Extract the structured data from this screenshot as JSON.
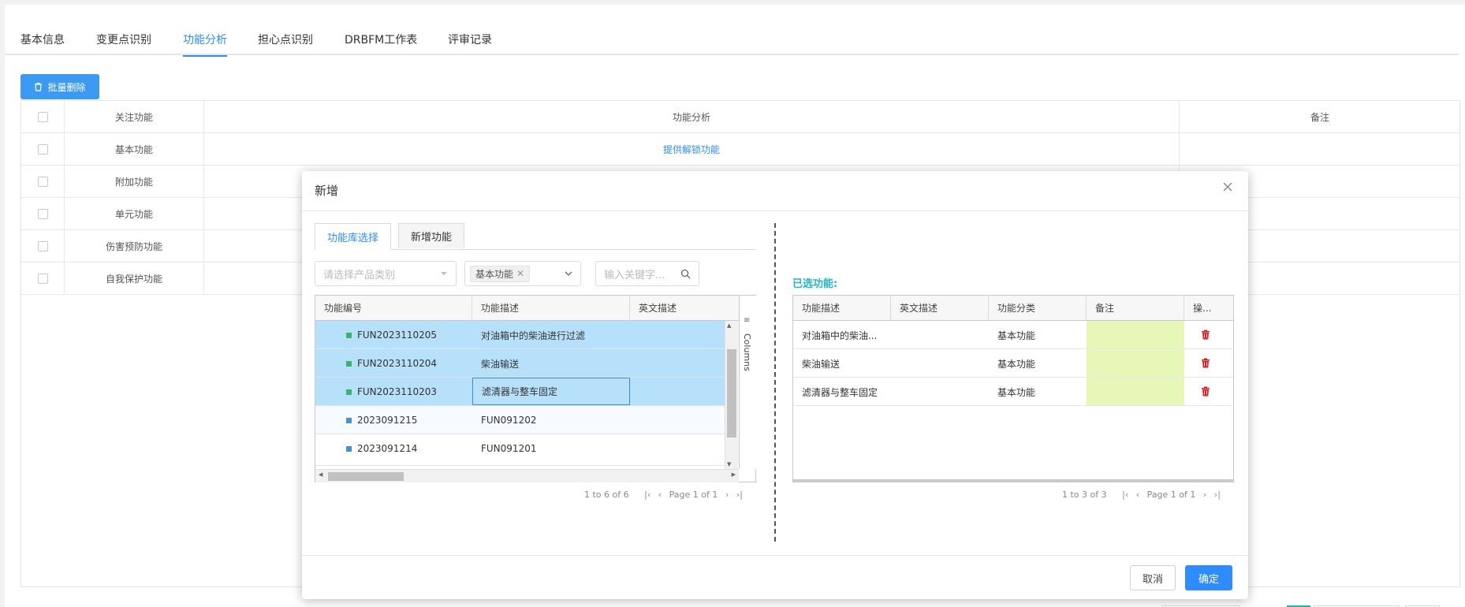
{
  "tabs": [
    "基本信息",
    "变更点识别",
    "功能分析",
    "担心点识别",
    "DRBFM工作表",
    "评审记录"
  ],
  "active_tab": "功能分析",
  "toolbar": {
    "batch_delete_label": "批量删除"
  },
  "background_table": {
    "headers": [
      "关注功能",
      "功能分析",
      "备注"
    ],
    "rows": [
      {
        "focus": "基本功能",
        "analysis": "提供解锁功能"
      },
      {
        "focus": "附加功能",
        "analysis": ""
      },
      {
        "focus": "单元功能",
        "analysis": ""
      },
      {
        "focus": "伤害预防功能",
        "analysis": ""
      },
      {
        "focus": "自我保护功能",
        "analysis": ""
      }
    ]
  },
  "modal": {
    "title": "新增",
    "sub_tabs": [
      "功能库选择",
      "新增功能"
    ],
    "active_sub_tab": "功能库选择",
    "filters": {
      "category_placeholder": "请选择产品类别",
      "selected_chip": "基本功能",
      "keyword_placeholder": "输入关键字..."
    },
    "left_grid": {
      "columns": [
        "功能编号",
        "功能描述",
        "英文描述"
      ],
      "side_label": "Columns",
      "rows": [
        {
          "id": "FUN2023110205",
          "desc": "对油箱中的柴油进行过滤",
          "en": "",
          "selected": true,
          "marker_color": "#3cb36a"
        },
        {
          "id": "FUN2023110204",
          "desc": "柴油输送",
          "en": "",
          "selected": true,
          "marker_color": "#3cb36a"
        },
        {
          "id": "FUN2023110203",
          "desc": "滤清器与整车固定",
          "en": "",
          "selected": true,
          "marker_color": "#3cb36a"
        },
        {
          "id": "2023091215",
          "desc": "FUN091202",
          "en": "",
          "selected": false,
          "marker_color": "#4a8fd0"
        },
        {
          "id": "2023091214",
          "desc": "FUN091201",
          "en": "",
          "selected": false,
          "marker_color": "#4a8fd0"
        }
      ],
      "pager": {
        "range": "1 to 6 of 6",
        "page": "Page 1 of 1"
      }
    },
    "selected_title": "已选功能:",
    "right_grid": {
      "columns": [
        "功能描述",
        "英文描述",
        "功能分类",
        "备注",
        "操..."
      ],
      "rows": [
        {
          "desc": "对油箱中的柴油...",
          "en": "",
          "category": "基本功能",
          "note": ""
        },
        {
          "desc": "柴油输送",
          "en": "",
          "category": "基本功能",
          "note": ""
        },
        {
          "desc": "滤清器与整车固定",
          "en": "",
          "category": "基本功能",
          "note": ""
        }
      ],
      "pager": {
        "range": "1 to 3 of 3",
        "page": "Page 1 of 1"
      }
    },
    "cancel_label": "取消",
    "confirm_label": "确定"
  },
  "colors": {
    "primary": "#2f8cff",
    "selected_row": "#b7e1fb",
    "note_cell": "#e6f7b8",
    "selected_title": "#21b6c4",
    "delete_icon": "#e02020"
  }
}
